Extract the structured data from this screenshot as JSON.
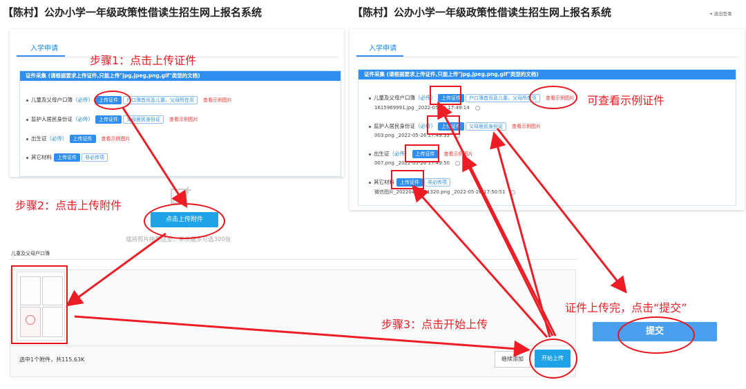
{
  "left_panel": {
    "title": "【陈村】公办小学一年级政策性借读生招生网上报名系统",
    "tab": "入学申请",
    "card_header": "证件采集 (请根据要求上传证件,只能上传\"jpg,jpeg,png,gif\"类型的文档)",
    "rows": [
      {
        "label": "儿童及父母户口簿",
        "required": "（必传）",
        "upload": "上传证件",
        "hint": "户口簿首页及儿童、父母所在页",
        "sample": "查看示例图片"
      },
      {
        "label": "监护人居民身份证",
        "required": "（必传）",
        "upload": "上传证件",
        "hint": "父母居民身份证",
        "sample": "查看示例图片"
      },
      {
        "label": "出生证",
        "required": "（必传）",
        "upload": "上传证件",
        "hint": "",
        "sample": "查看示例图片"
      },
      {
        "label": "其它材料",
        "required": "",
        "upload": "上传证件",
        "hint": "非必传项",
        "sample": ""
      }
    ],
    "upload_attach_button": "点击上传附件",
    "upload_note": "或将照片拖到这里，单次最多可选300张"
  },
  "right_panel": {
    "title": "【陈村】公办小学一年级政策性借读生招生网上报名系统",
    "logout": "退出登录",
    "tab": "入学申请",
    "card_header": "证件采集 (请根据要求上传证件,只能上传\"jpg,jpeg,png,gif\"类型的文档)",
    "rows": [
      {
        "label": "儿童及父母户口簿",
        "required": "（必传）",
        "upload": "上传证件",
        "hint": "户口簿首页及儿童、父母所在页",
        "sample": "查看示例图片",
        "file": "1615969991.jpg _2022-05-26 17:49:14"
      },
      {
        "label": "监护人居民身份证",
        "required": "（必传）",
        "upload": "上传证件",
        "hint": "父母居民身份证",
        "sample": "查看示例图片",
        "file": "003.png _2022-05-26 17:49:33"
      },
      {
        "label": "出生证",
        "required": "（必传）",
        "upload": "上传证件",
        "hint": "",
        "sample": "查看示例图片",
        "file": "007.png _2022-05-26 17:49:50"
      },
      {
        "label": "其它材料",
        "required": "",
        "upload": "上传证件",
        "hint": "非必传项",
        "sample": "",
        "file": "微信图片_20220424141320.png _2022-05-26 17:50:51"
      }
    ],
    "submit_button": "提交"
  },
  "bottom_panel": {
    "section_title": "儿童及父母户口簿",
    "status": "选中1个附件，共115.63K",
    "continue_button": "继续添加",
    "start_button": "开始上传"
  },
  "annotations": {
    "step1": "步骤1：点击上传证件",
    "step2": "步骤2：点击上传附件",
    "step3": "步骤3：点击开始上传",
    "sample_note": "可查看示例证件",
    "submit_note": "证件上传完，点击“提交”"
  },
  "colors": {
    "accent": "#2f8ef0",
    "annotation": "#ee1c25",
    "upload_button": "#1fa3e8"
  }
}
